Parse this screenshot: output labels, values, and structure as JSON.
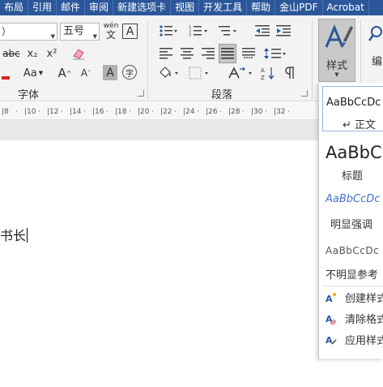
{
  "menu": {
    "tabs": [
      "布局",
      "引用",
      "邮件",
      "审阅",
      "新建选项卡",
      "视图",
      "开发工具",
      "帮助",
      "金山PDF",
      "Acrobat"
    ]
  },
  "ribbon": {
    "font_name_partial": "）",
    "font_size": "五号",
    "wen_top": "wén",
    "wen_bottom": "文",
    "char_border": "A",
    "strike": "abc",
    "subscript": "x₂",
    "superscript": "x²",
    "change_case": "Aa",
    "grow": "A",
    "shrink": "A",
    "shading_char": "A",
    "enclose_char": "字",
    "group_font": "字体",
    "group_paragraph": "段落",
    "styles_label": "样式",
    "edit_label": "编"
  },
  "ruler": {
    "ticks": [
      "8",
      "10",
      "12",
      "14",
      "16",
      "18",
      "20",
      "22",
      "24",
      "26",
      "28",
      "30",
      "32"
    ]
  },
  "document": {
    "text": "书长"
  },
  "styles_pane": {
    "normal_preview": "AaBbCcDc",
    "normal_name": "↵ 正文",
    "title_preview": "AaBbC",
    "title_name": "标题",
    "emphasis_preview": "AaBbCcDc",
    "emphasis_name": "明显强调",
    "subtle_ref_preview": "AaBbCcDc",
    "subtle_ref_name": "不明显参考",
    "create_style": "创建样式",
    "clear_format": "清除格式",
    "apply_style": "应用样式"
  },
  "colors": {
    "accent": "#2b579a",
    "font_color_red": "#e02020",
    "highlight_yellow": "#ffff00"
  }
}
